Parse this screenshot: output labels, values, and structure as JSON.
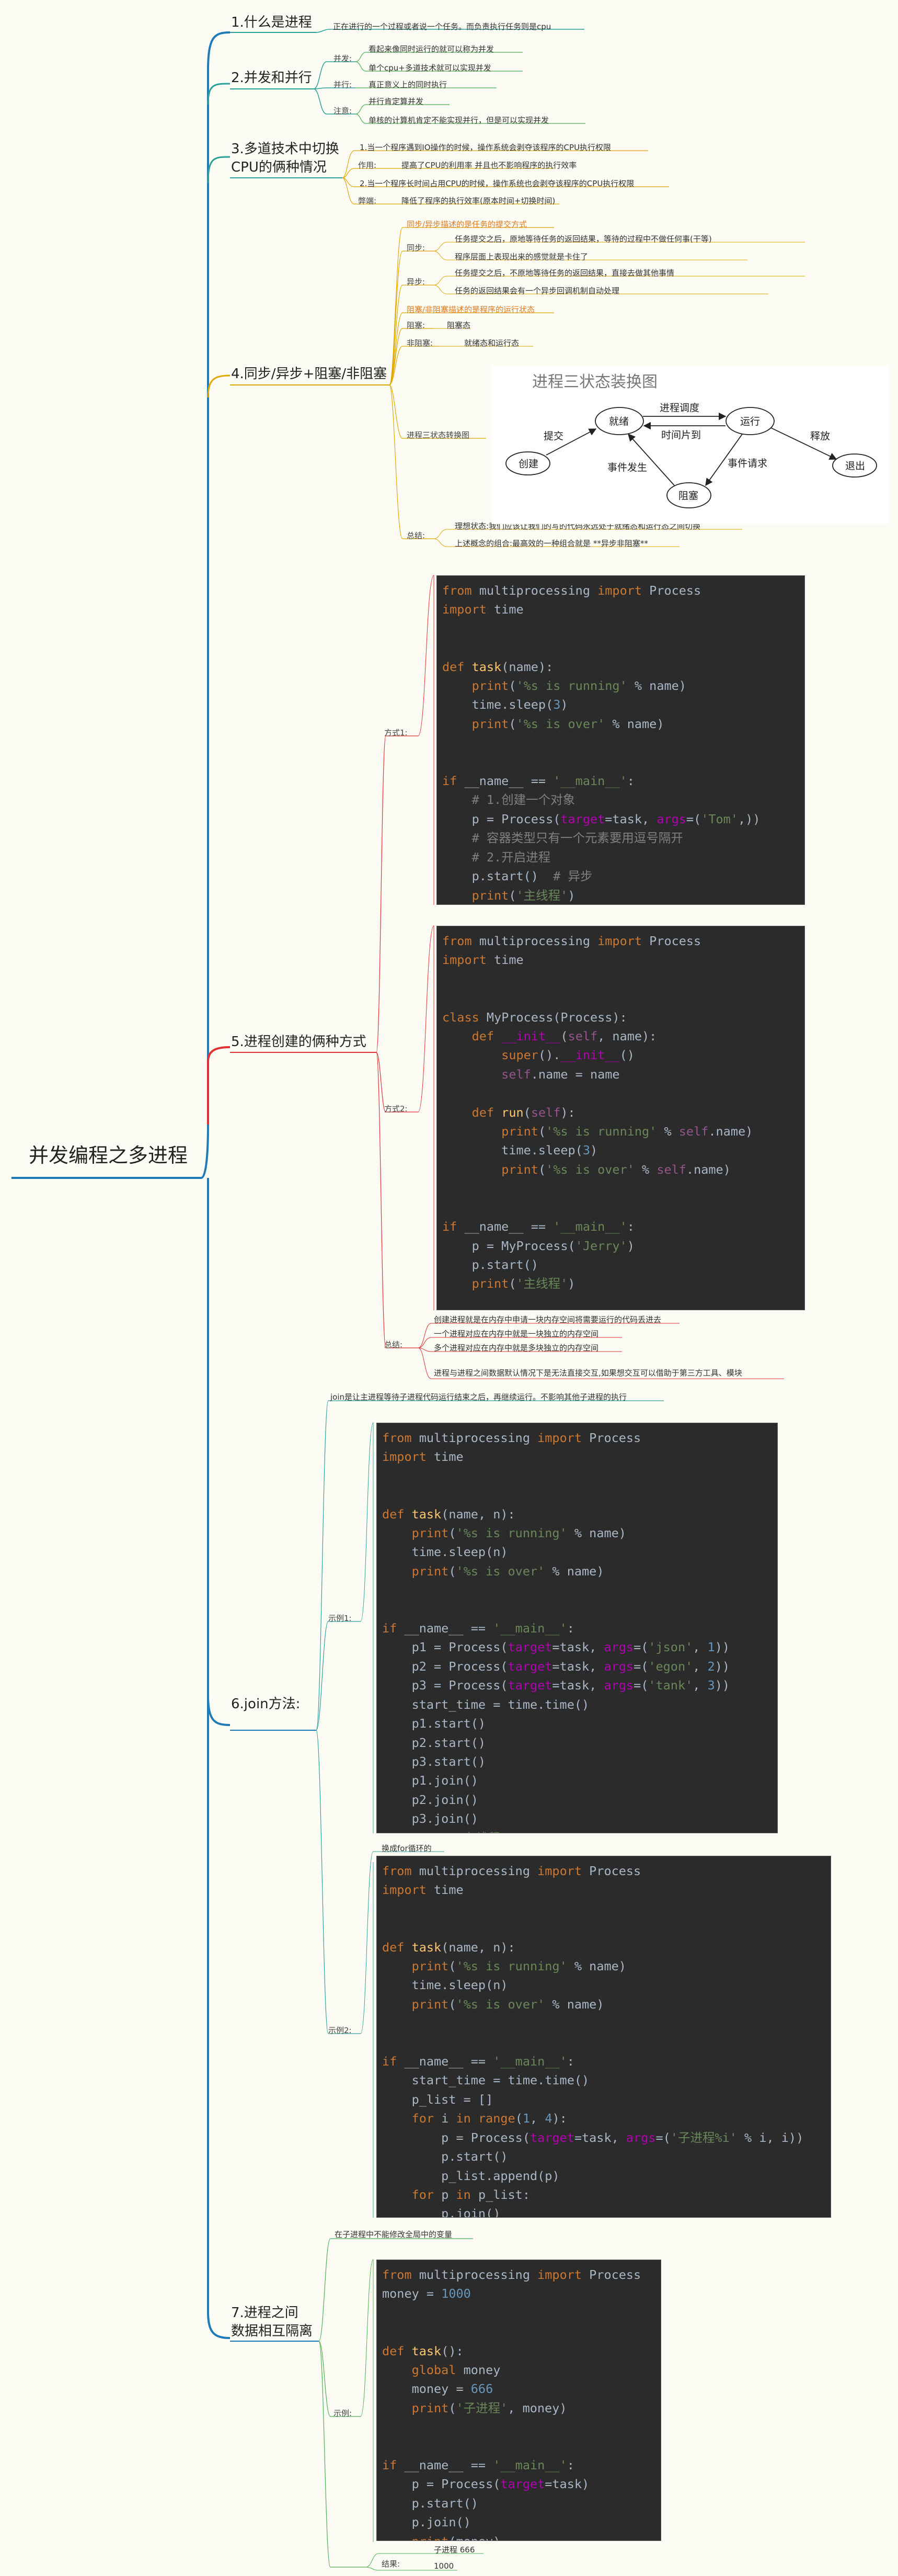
{
  "root": "并发编程之多进程",
  "s1": {
    "title": "1.什么是进程",
    "leaf": "正在进行的一个过程或者说一个任务。而负责执行任务则是cpu"
  },
  "s2": {
    "title": "2.并发和并行",
    "concurrent_label": "并发:",
    "concurrent_items": [
      "看起来像同时运行的就可以称为并发",
      "单个cpu+多道技术就可以实现并发"
    ],
    "parallel_label": "并行:",
    "parallel_item": "真正意义上的同时执行",
    "note_label": "注意:",
    "note_items": [
      "并行肯定算并发",
      "单核的计算机肯定不能实现并行，但是可以实现并发"
    ]
  },
  "s3": {
    "title": "3.多道技术中切换CPU的俩种情况",
    "title_line1": "3.多道技术中切换",
    "title_line2": "CPU的俩种情况",
    "case1": "1.当一个程序遇到IO操作的时候，操作系统会剥夺该程序的CPU执行权限",
    "effect_label": "作用:",
    "effect": "提高了CPU的利用率 并且也不影响程序的执行效率",
    "case2": "2.当一个程序长时间占用CPU的时候，操作系统也会剥夺该程序的CPU执行权限",
    "drawback_label": "弊端:",
    "drawback": "降低了程序的执行效率(原本时间+切换时间)"
  },
  "s4": {
    "title": "4.同步/异步+阻塞/非阻塞",
    "sync_header": "同步/异步描述的是任务的提交方式",
    "sync_label": "同步:",
    "sync_items": [
      "任务提交之后，原地等待任务的返回结果，等待的过程中不做任何事(干等)",
      "程序层面上表现出来的感觉就是卡住了"
    ],
    "async_label": "异步:",
    "async_items": [
      "任务提交之后，不原地等待任务的返回结果，直接去做其他事情",
      "任务的返回结果会有一个异步回调机制自动处理"
    ],
    "block_header": "阻塞/非阻塞描述的是程序的运行状态",
    "block_label": "阻塞:",
    "block_item": "阻塞态",
    "nonblock_label": "非阻塞:",
    "nonblock_item": "就绪态和运行态",
    "diagram_label": "进程三状态转换图",
    "summary_label": "总结:",
    "summary_items": [
      "理想状态:我们应该让我们的写的代码永远处于就绪态和运行态之间切换",
      "上述概念的组合:最高效的一种组合就是  **异步非阻塞**"
    ]
  },
  "state_diagram": {
    "title": "进程三状态装换图",
    "create": "创建",
    "ready": "就绪",
    "running": "运行",
    "blocked": "阻塞",
    "exit": "退出",
    "submit": "提交",
    "schedule": "进程调度",
    "timeslice": "时间片到",
    "release": "释放",
    "event_request": "事件请求",
    "event_occur": "事件发生"
  },
  "s5": {
    "title": "5.进程创建的俩种方式",
    "way1_label": "方式1:",
    "way2_label": "方式2:",
    "summary_label": "总结:",
    "summary_items": [
      "创建进程就是在内存中申请一块内存空间将需要运行的代码丢进去",
      "一个进程对应在内存中就是一块独立的内存空间",
      "多个进程对应在内存中就是多块独立的内存空间",
      "进程与进程之间数据默认情况下是无法直接交互,如果想交互可以借助于第三方工具、模块"
    ]
  },
  "s6": {
    "title": "6.join方法:",
    "desc": "join是让主进程等待子进程代码运行结束之后，再继续运行。不影响其他子进程的执行",
    "ex1_label": "示例1:",
    "ex2_label": "示例2:",
    "ex2_note": "换成for循环的"
  },
  "s7": {
    "title": "7.进程之间数据相互隔离",
    "title_line1": "7.进程之间",
    "title_line2": "数据相互隔离",
    "desc": "在子进程中不能修改全局中的变量",
    "ex_label": "示例:",
    "result_label": "结果:",
    "results": [
      "子进程 666",
      "1000"
    ]
  },
  "colors": {
    "orange": "#e27a1f",
    "red": "#e03030",
    "teal": "#2aa198",
    "green": "#4caf50",
    "blue": "#1f7ab8",
    "gold": "#e0a800",
    "code_bg": "#2b2b2b"
  }
}
